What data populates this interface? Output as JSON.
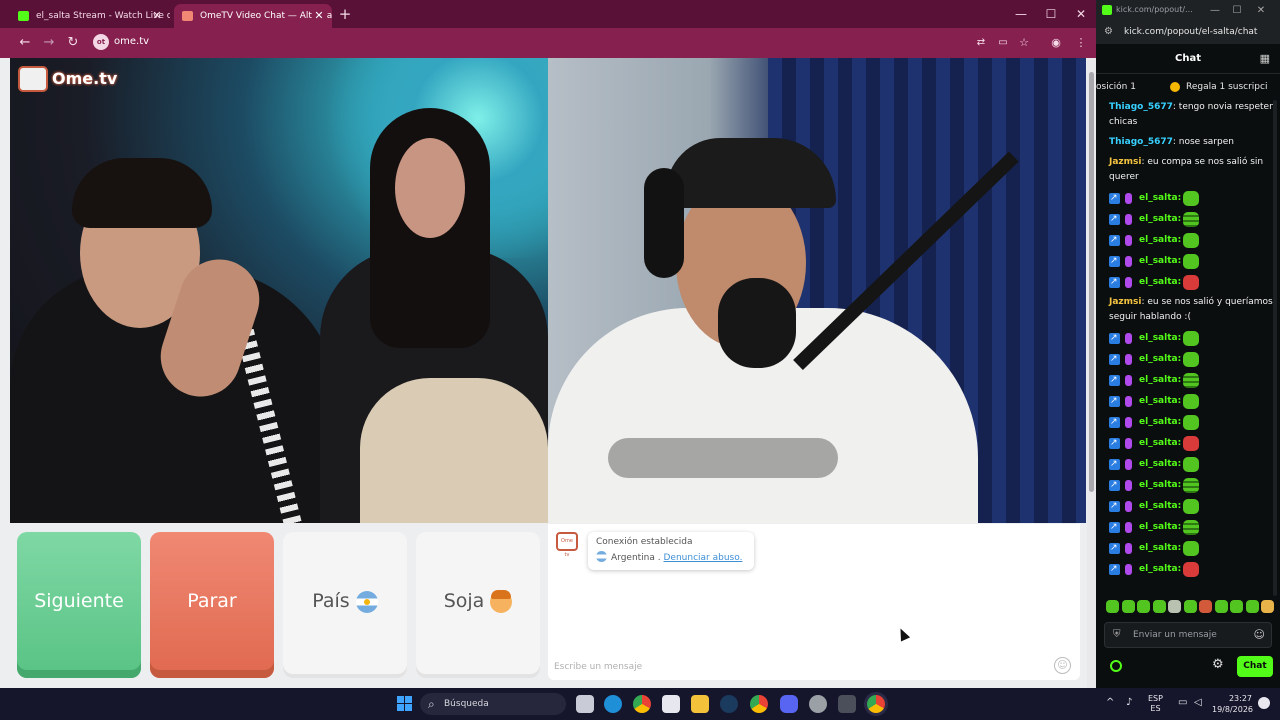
{
  "browser": {
    "tabs": [
      {
        "title": "el_salta Stream - Watch Live on Kick",
        "close": "✕"
      },
      {
        "title": "OmeTV Video Chat — Alternative",
        "close": "✕"
      }
    ],
    "new_tab": "+",
    "window_controls": {
      "minimize": "—",
      "maximize": "☐",
      "close": "✕"
    },
    "nav": {
      "back": "←",
      "forward": "→",
      "reload": "↻"
    },
    "site_chip": "ot",
    "address": "ome.tv",
    "toolbar_icons": [
      "translate-icon",
      "cast-icon",
      "star-icon",
      "profile-icon",
      "menu-icon"
    ],
    "colors": {
      "tabstrip": "#5a1138",
      "toolbar": "#86204f"
    }
  },
  "ometv": {
    "logo_text": "Ome.tv",
    "buttons": {
      "next": "Siguiente",
      "stop": "Parar",
      "country": "País",
      "gender": "Soja"
    },
    "chat": {
      "status": "Conexión establecida",
      "country": "Argentina .",
      "report": "Denunciar abuso.",
      "input_placeholder": "Escribe un mensaje",
      "logo": "Ome tv"
    },
    "colors": {
      "next": "#58c384",
      "stop": "#e0694f"
    }
  },
  "kick": {
    "title_url": "kick.com/popout/...",
    "url": "kick.com/popout/el-salta/chat",
    "header": "Chat",
    "pinned": {
      "left": "osición 1",
      "right": "Regala 1 suscripci"
    },
    "messages": [
      {
        "type": "text",
        "user": "Thiago_5677",
        "color": "#37d0ff",
        "text": ": tengo novia respeten chicas"
      },
      {
        "type": "text",
        "user": "Thiago_5677",
        "color": "#37d0ff",
        "text": ": nose sarpen"
      },
      {
        "type": "text",
        "user": "Jazmsi",
        "color": "#f5c542",
        "text": ": eu compa se nos salió sin querer"
      },
      {
        "type": "emote",
        "user": "el_salta:",
        "emote": "green"
      },
      {
        "type": "emote",
        "user": "el_salta:",
        "emote": "lined"
      },
      {
        "type": "emote",
        "user": "el_salta:",
        "emote": "green"
      },
      {
        "type": "emote",
        "user": "el_salta:",
        "emote": "green"
      },
      {
        "type": "emote",
        "user": "el_salta:",
        "emote": "red"
      },
      {
        "type": "text",
        "user": "Jazmsi",
        "color": "#f5c542",
        "text": ": eu se nos salió y queríamos seguir hablando :("
      },
      {
        "type": "emote",
        "user": "el_salta:",
        "emote": "green"
      },
      {
        "type": "emote",
        "user": "el_salta:",
        "emote": "green"
      },
      {
        "type": "emote",
        "user": "el_salta:",
        "emote": "lined"
      },
      {
        "type": "emote",
        "user": "el_salta:",
        "emote": "green"
      },
      {
        "type": "emote",
        "user": "el_salta:",
        "emote": "green"
      },
      {
        "type": "emote",
        "user": "el_salta:",
        "emote": "red"
      },
      {
        "type": "emote",
        "user": "el_salta:",
        "emote": "green"
      },
      {
        "type": "emote",
        "user": "el_salta:",
        "emote": "lined"
      },
      {
        "type": "emote",
        "user": "el_salta:",
        "emote": "green"
      },
      {
        "type": "emote",
        "user": "el_salta:",
        "emote": "lined"
      },
      {
        "type": "emote",
        "user": "el_salta:",
        "emote": "green"
      },
      {
        "type": "emote",
        "user": "el_salta:",
        "emote": "red"
      }
    ],
    "input_placeholder": "Enviar un mensaje",
    "send": "Chat",
    "colors": {
      "brand": "#53fc18",
      "bg": "#0b0e0f"
    }
  },
  "taskbar": {
    "search": "Búsqueda",
    "apps": [
      "explorer-icon",
      "edge-icon",
      "chrome-icon",
      "store-icon",
      "files-icon",
      "steam-icon",
      "chrome-icon",
      "discord-icon",
      "chrome-alt-icon",
      "calculator-icon",
      "chrome-active-icon"
    ],
    "tray": {
      "arrow": "^",
      "lang_top": "ESP",
      "lang_bottom": "ES",
      "time": "23:27",
      "date": "19/8/2026"
    }
  }
}
